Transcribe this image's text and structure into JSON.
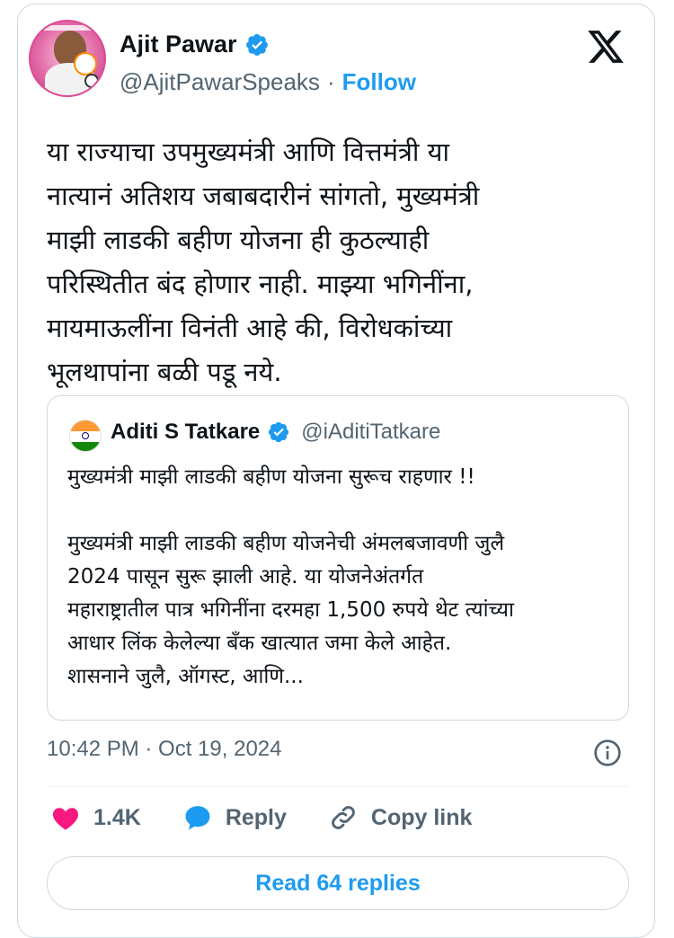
{
  "author": {
    "name": "Ajit Pawar",
    "handle": "@AjitPawarSpeaks",
    "follow_label": "Follow",
    "verified_icon": "verified-badge-icon"
  },
  "brand_icon": "x-logo-icon",
  "tweet": {
    "lines": [
      "या राज्याचा उपमुख्यमंत्री आणि वित्तमंत्री या",
      "नात्यानं अतिशय जबाबदारीनं सांगतो, मुख्यमंत्री",
      "माझी लाडकी बहीण योजना ही कुठल्याही",
      "परिस्थितीत बंद होणार नाही. माझ्या भगिनींना,",
      "मायमाऊलींना विनंती आहे की, विरोधकांच्या",
      "भूलथापांना बळी पडू नये."
    ]
  },
  "quote": {
    "name": "Aditi S Tatkare",
    "handle": "@iAditiTatkare",
    "lines": [
      "मुख्यमंत्री माझी लाडकी बहीण योजना सुरूच राहणार !!",
      "",
      "मुख्यमंत्री माझी लाडकी बहीण योजनेची अंमलबजावणी जुलै",
      "2024 पासून सुरू झाली आहे. या योजनेअंतर्गत",
      "महाराष्ट्रातील पात्र भगिनींना दरमहा 1,500 रुपये थेट त्यांच्या",
      "आधार लिंक केलेल्या बँक खात्यात जमा केले आहेत.",
      "शासनाने जुलै, ऑगस्ट, आणि..."
    ]
  },
  "timestamp": "10:42 PM · Oct 19, 2024",
  "actions": {
    "like_count": "1.4K",
    "reply_label": "Reply",
    "copy_label": "Copy link"
  },
  "read_replies_label": "Read 64 replies",
  "colors": {
    "accent": "#1d9bf0",
    "like": "#f91880",
    "text": "#0f1419",
    "muted": "#536471",
    "border": "#cfd9de"
  }
}
